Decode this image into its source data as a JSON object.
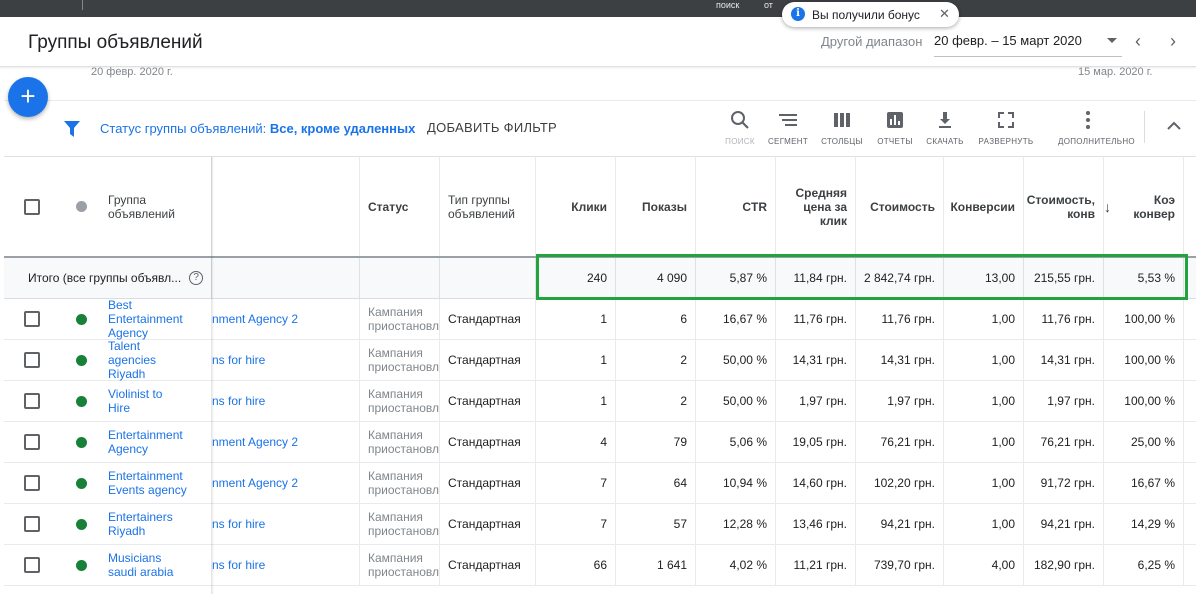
{
  "topbar": {
    "left_text": "поиск",
    "right_text": "от"
  },
  "header": {
    "title": "Группы объявлений",
    "range_label": "Другой диапазон",
    "range_value": "20 февр. – 15 март 2020"
  },
  "toast": {
    "text": "Вы получили бонус"
  },
  "date_axis": {
    "start": "20 февр. 2020 г.",
    "end": "15 мар. 2020 г."
  },
  "filter": {
    "label": "Статус группы объявлений:",
    "value": "Все, кроме удаленных",
    "add_filter": "ДОБАВИТЬ ФИЛЬТР"
  },
  "toolbar": {
    "search": "ПОИСК",
    "segment": "СЕГМЕНТ",
    "columns": "СТОЛБЦЫ",
    "reports": "ОТЧЕТЫ",
    "download": "СКАЧАТЬ",
    "expand": "РАЗВЕРНУТЬ",
    "more": "ДОПОЛНИТЕЛЬНО"
  },
  "columns": {
    "group": "Группа объявлений",
    "status": "Статус",
    "type": "Тип группы объявлений",
    "clicks": "Клики",
    "impressions": "Показы",
    "ctr": "CTR",
    "avg_cpc": "Средняя цена за клик",
    "cost": "Стоимость",
    "conversions": "Конверсии",
    "cost_per_conv": "Стоимость, конв",
    "conv_rate": "Коэ конвер"
  },
  "total": {
    "label": "Итого (все группы объявл...",
    "clicks": "240",
    "impressions": "4 090",
    "ctr": "5,87 %",
    "avg_cpc": "11,84 грн.",
    "cost": "2 842,74 грн.",
    "conversions": "13,00",
    "cost_per_conv": "215,55 грн.",
    "conv_rate": "5,53 %"
  },
  "rows": [
    {
      "name_l1": "Best",
      "name_l2": "Entertainment",
      "name_l3": "Agency",
      "campaign": "nment Agency 2",
      "status_l1": "Кампания",
      "status_l2": "приостановл",
      "type": "Стандартная",
      "clicks": "1",
      "impressions": "6",
      "ctr": "16,67 %",
      "avg_cpc": "11,76 грн.",
      "cost": "11,76 грн.",
      "conversions": "1,00",
      "cost_per_conv": "11,76 грн.",
      "conv_rate": "100,00 %"
    },
    {
      "name_l1": "Talent",
      "name_l2": "agencies",
      "name_l3": "Riyadh",
      "campaign": "ns for hire",
      "status_l1": "Кампания",
      "status_l2": "приостановл",
      "type": "Стандартная",
      "clicks": "1",
      "impressions": "2",
      "ctr": "50,00 %",
      "avg_cpc": "14,31 грн.",
      "cost": "14,31 грн.",
      "conversions": "1,00",
      "cost_per_conv": "14,31 грн.",
      "conv_rate": "100,00 %"
    },
    {
      "name_l1": "Violinist to",
      "name_l2": "Hire",
      "name_l3": "",
      "campaign": "ns for hire",
      "status_l1": "Кампания",
      "status_l2": "приостановл",
      "type": "Стандартная",
      "clicks": "1",
      "impressions": "2",
      "ctr": "50,00 %",
      "avg_cpc": "1,97 грн.",
      "cost": "1,97 грн.",
      "conversions": "1,00",
      "cost_per_conv": "1,97 грн.",
      "conv_rate": "100,00 %"
    },
    {
      "name_l1": "Entertainment",
      "name_l2": "Agency",
      "name_l3": "",
      "campaign": "nment Agency 2",
      "status_l1": "Кампания",
      "status_l2": "приостановл",
      "type": "Стандартная",
      "clicks": "4",
      "impressions": "79",
      "ctr": "5,06 %",
      "avg_cpc": "19,05 грн.",
      "cost": "76,21 грн.",
      "conversions": "1,00",
      "cost_per_conv": "76,21 грн.",
      "conv_rate": "25,00 %"
    },
    {
      "name_l1": "Entertainment",
      "name_l2": "Events agency",
      "name_l3": "",
      "campaign": "nment Agency 2",
      "status_l1": "Кампания",
      "status_l2": "приостановл",
      "type": "Стандартная",
      "clicks": "7",
      "impressions": "64",
      "ctr": "10,94 %",
      "avg_cpc": "14,60 грн.",
      "cost": "102,20 грн.",
      "conversions": "1,00",
      "cost_per_conv": "91,72 грн.",
      "conv_rate": "16,67 %"
    },
    {
      "name_l1": "Entertainers",
      "name_l2": "Riyadh",
      "name_l3": "",
      "campaign": "ns for hire",
      "status_l1": "Кампания",
      "status_l2": "приостановл",
      "type": "Стандартная",
      "clicks": "7",
      "impressions": "57",
      "ctr": "12,28 %",
      "avg_cpc": "13,46 грн.",
      "cost": "94,21 грн.",
      "conversions": "1,00",
      "cost_per_conv": "94,21 грн.",
      "conv_rate": "14,29 %"
    },
    {
      "name_l1": "Musicians",
      "name_l2": "saudi arabia",
      "name_l3": "",
      "campaign": "ns for hire",
      "status_l1": "Кампания",
      "status_l2": "приостановл",
      "type": "Стандартная",
      "clicks": "66",
      "impressions": "1 641",
      "ctr": "4,02 %",
      "avg_cpc": "11,21 грн.",
      "cost": "739,70 грн.",
      "conversions": "4,00",
      "cost_per_conv": "182,90 грн.",
      "conv_rate": "6,25 %"
    }
  ]
}
